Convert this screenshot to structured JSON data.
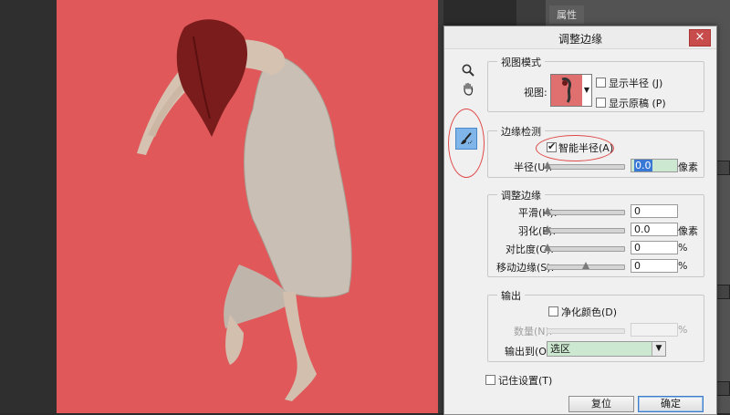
{
  "ps_panel": {
    "properties_tab": "属性"
  },
  "dialog": {
    "title": "调整边缘",
    "close_glyph": "×",
    "view_mode": {
      "legend": "视图模式",
      "view_label": "视图:",
      "show_radius": "显示半径 (J)",
      "show_original": "显示原稿 (P)"
    },
    "edge_detection": {
      "legend": "边缘检测",
      "smart_radius": "智能半径(A)",
      "smart_radius_checked": true,
      "radius_label": "半径(U):",
      "radius_value": "0.0",
      "radius_unit": "像素",
      "radius_level": 0.0
    },
    "adjust_edge": {
      "legend": "调整边缘",
      "smooth_label": "平滑(H):",
      "smooth_value": "0",
      "smooth_level": 0.0,
      "feather_label": "羽化(E):",
      "feather_value": "0.0",
      "feather_unit": "像素",
      "feather_level": 0.0,
      "contrast_label": "对比度(C):",
      "contrast_value": "0",
      "contrast_unit": "%",
      "contrast_level": 0.0,
      "shift_label": "移动边缘(S):",
      "shift_value": "0",
      "shift_unit": "%",
      "shift_level": 0.5
    },
    "output": {
      "legend": "输出",
      "decontaminate": "净化颜色(D)",
      "amount_label": "数量(N):",
      "amount_unit": "%",
      "output_to_label": "输出到(O):",
      "output_to_value": "选区"
    },
    "remember_settings": "记住设置(T)",
    "reset_button": "复位",
    "ok_button": "确定"
  },
  "colors": {
    "canvas_bg": "#e0585a",
    "annotation_red": "#e04848",
    "active_tool": "#7fb5e8",
    "field_green": "#cde8d0"
  },
  "icons": [
    "zoom-icon",
    "hand-icon",
    "refine-radius-brush-icon",
    "dropdown-arrow-icon",
    "checkbox-icon"
  ]
}
